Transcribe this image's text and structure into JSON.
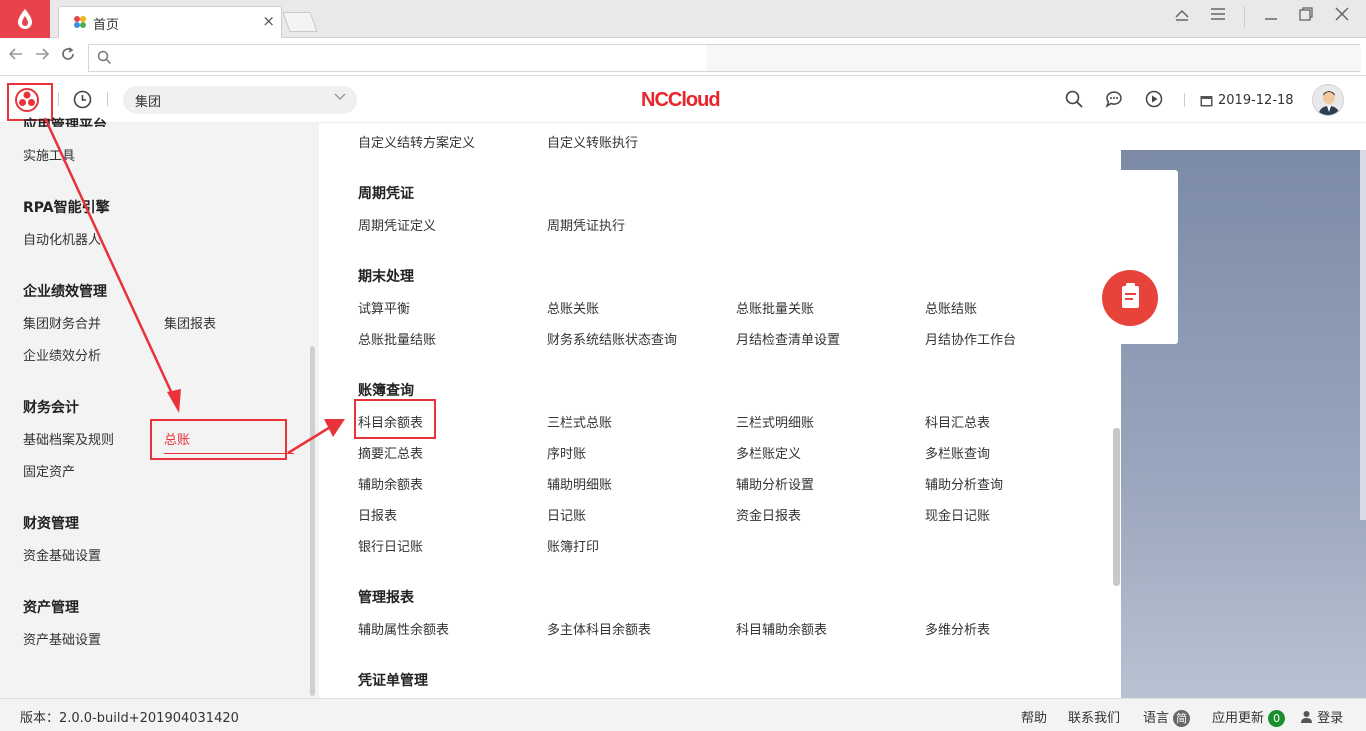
{
  "browser": {
    "tab_title": "首页",
    "tab_close": "×"
  },
  "header": {
    "brand": "NCCloud",
    "org_selector": "集团",
    "date": "2019-12-18"
  },
  "left_menu": {
    "partial_heading": "应用管理平台",
    "sections": [
      {
        "heading": "",
        "items": [
          "实施工具"
        ]
      },
      {
        "heading": "RPA智能引擎",
        "items": [
          "自动化机器人"
        ]
      },
      {
        "heading": "企业绩效管理",
        "items": [
          "集团财务合并",
          "集团报表",
          "企业绩效分析"
        ]
      },
      {
        "heading": "财务会计",
        "items": [
          "基础档案及规则",
          "总账",
          "固定资产"
        ]
      },
      {
        "heading": "财资管理",
        "items": [
          "资金基础设置"
        ]
      },
      {
        "heading": "资产管理",
        "items": [
          "资产基础设置"
        ]
      }
    ]
  },
  "main_menu": {
    "top_items": [
      "自定义结转方案定义",
      "自定义转账执行"
    ],
    "groups": [
      {
        "heading": "周期凭证",
        "items": [
          "周期凭证定义",
          "周期凭证执行"
        ]
      },
      {
        "heading": "期末处理",
        "items": [
          "试算平衡",
          "总账关账",
          "总账批量关账",
          "总账结账",
          "总账批量结账",
          "财务系统结账状态查询",
          "月结检查清单设置",
          "月结协作工作台"
        ]
      },
      {
        "heading": "账簿查询",
        "items": [
          "科目余额表",
          "三栏式总账",
          "三栏式明细账",
          "科目汇总表",
          "摘要汇总表",
          "序时账",
          "多栏账定义",
          "多栏账查询",
          "辅助余额表",
          "辅助明细账",
          "辅助分析设置",
          "辅助分析查询",
          "日报表",
          "日记账",
          "资金日报表",
          "现金日记账",
          "银行日记账",
          "账簿打印"
        ]
      },
      {
        "heading": "管理报表",
        "items": [
          "辅助属性余额表",
          "多主体科目余额表",
          "科目辅助余额表",
          "多维分析表"
        ]
      },
      {
        "heading": "凭证单管理",
        "items": []
      }
    ]
  },
  "status_bar": {
    "version": "版本：2.0.0-build+201904031420",
    "help": "帮助",
    "contact": "联系我们",
    "language": "语言",
    "language_badge": "简",
    "updates": "应用更新",
    "updates_count": "0",
    "login": "登录"
  },
  "colors": {
    "brand_red": "#e8242c",
    "annotation_red": "#e8333a",
    "active_item": "#e8333a"
  }
}
